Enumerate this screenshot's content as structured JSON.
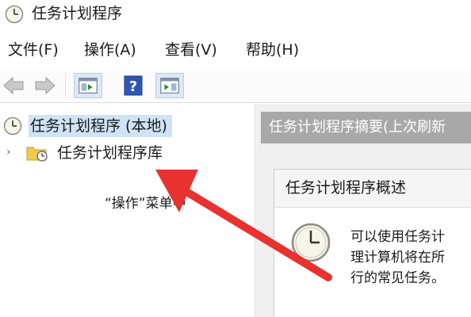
{
  "window": {
    "title": "任务计划程序",
    "icon": "clock-icon"
  },
  "menu": [
    "文件(F)",
    "操作(A)",
    "查看(V)",
    "帮助(H)"
  ],
  "toolbar": {
    "buttons": [
      "back-arrow-icon",
      "forward-arrow-icon",
      "show-hide-console-tree-icon",
      "help-icon",
      "show-hide-action-pane-icon"
    ]
  },
  "tree": {
    "root_label": "任务计划程序 (本地)",
    "child_expander": "›",
    "child_label": "任务计划程序库"
  },
  "right_pane": {
    "summary_header": "任务计划程序摘要(上次刷新",
    "overview_title": "任务计划程序概述",
    "overview_lines": [
      "可以使用任务计",
      "理计算机将在所",
      "行的常见任务。",
      "“操作”菜单中"
    ]
  },
  "colors": {
    "selection": "#cfe3f7",
    "header_bg": "#a8a8a8",
    "annotation_arrow": "#e8322f"
  }
}
